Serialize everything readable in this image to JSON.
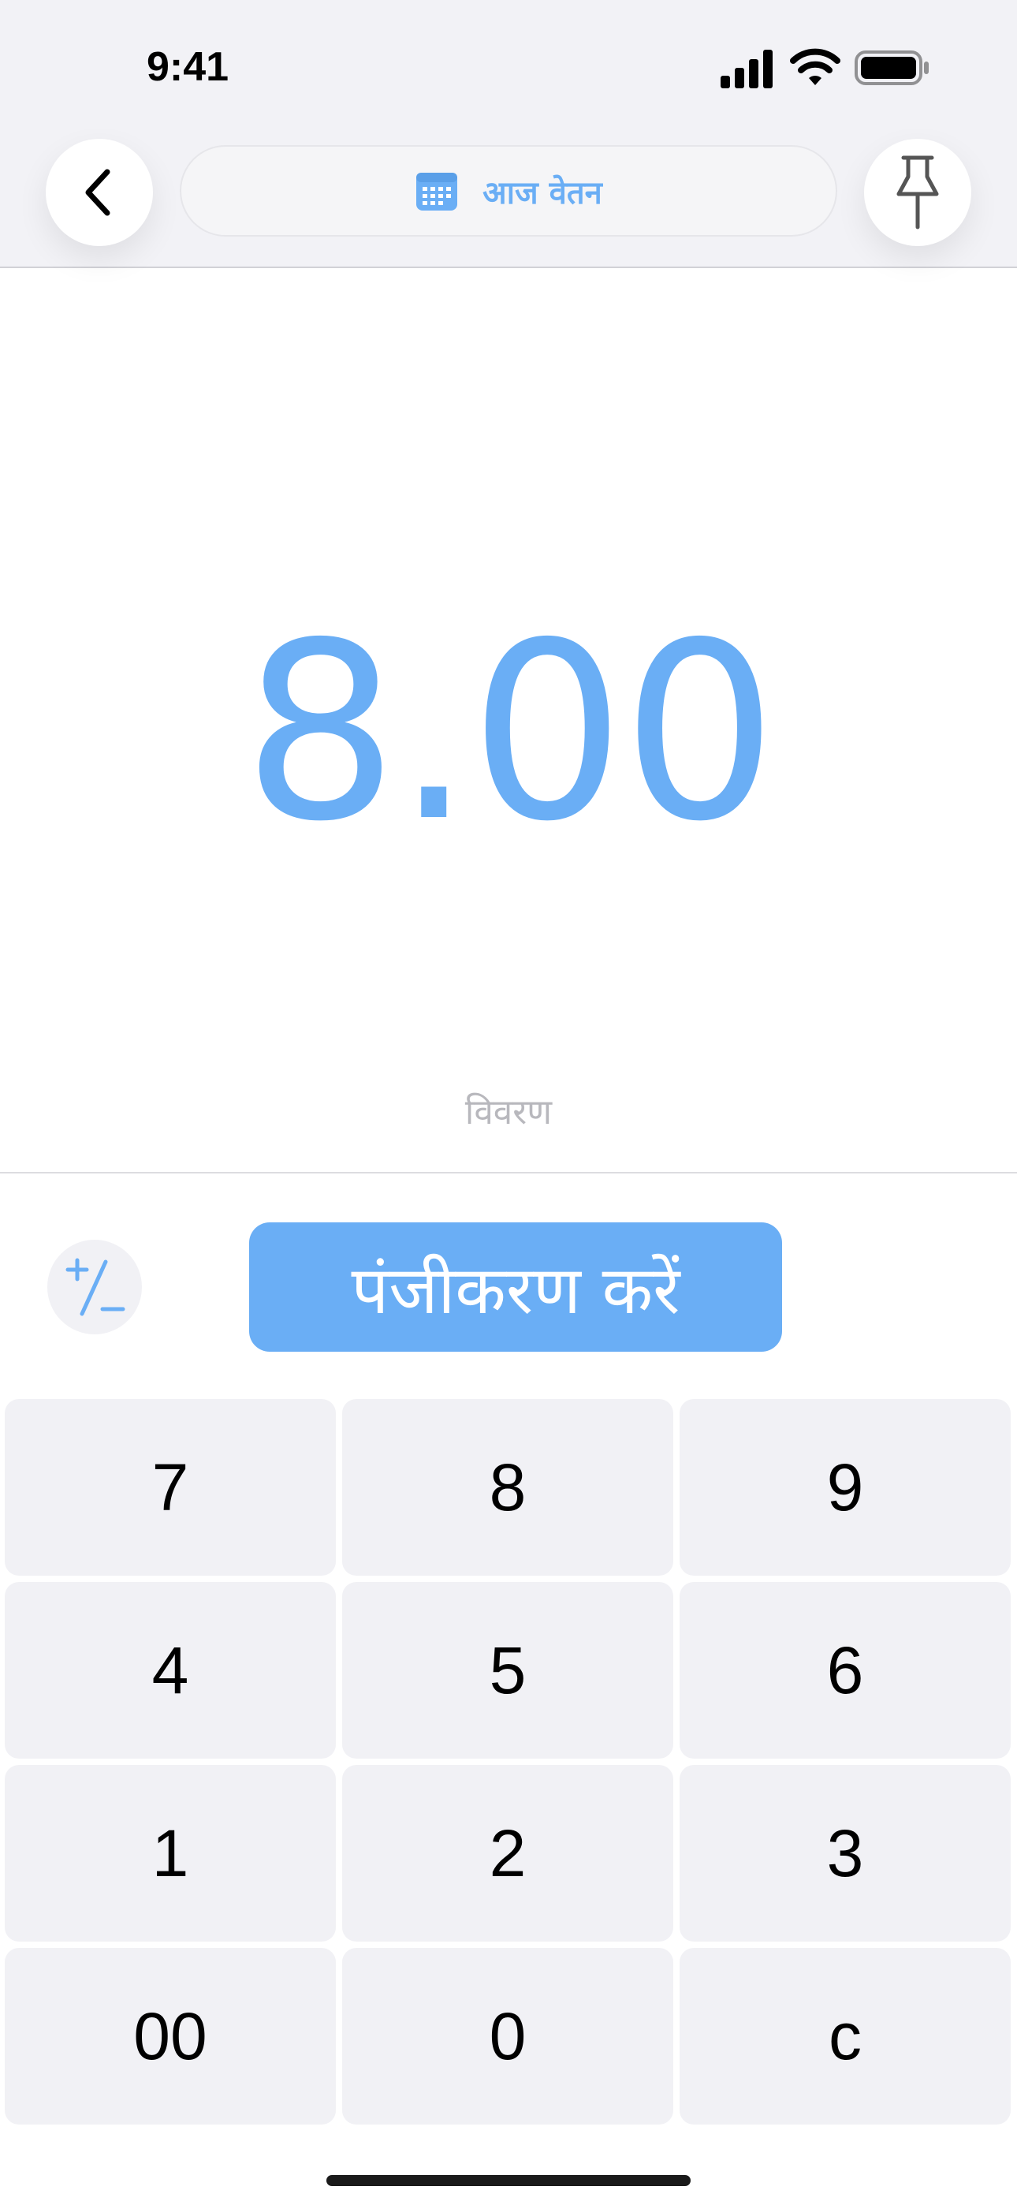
{
  "status_bar": {
    "time": "9:41",
    "icons": [
      "cellular-signal-icon",
      "wifi-icon",
      "battery-icon"
    ]
  },
  "header": {
    "back_icon": "chevron-left-icon",
    "calendar_icon": "calendar-icon",
    "title": "आज वेतन",
    "pin_icon": "pushpin-icon"
  },
  "amount": {
    "value": "8.00"
  },
  "description": {
    "placeholder": "विवरण"
  },
  "actions": {
    "sign_toggle_icon": "plus-minus-icon",
    "register_label": "पंजीकरण करें"
  },
  "keypad": {
    "keys": [
      "7",
      "8",
      "9",
      "4",
      "5",
      "6",
      "1",
      "2",
      "3",
      "00",
      "0",
      "c"
    ]
  },
  "colors": {
    "accent": "#6aaef5",
    "header_bg": "#f2f2f6",
    "key_bg": "#f1f1f5",
    "placeholder": "#b8b8bd"
  }
}
